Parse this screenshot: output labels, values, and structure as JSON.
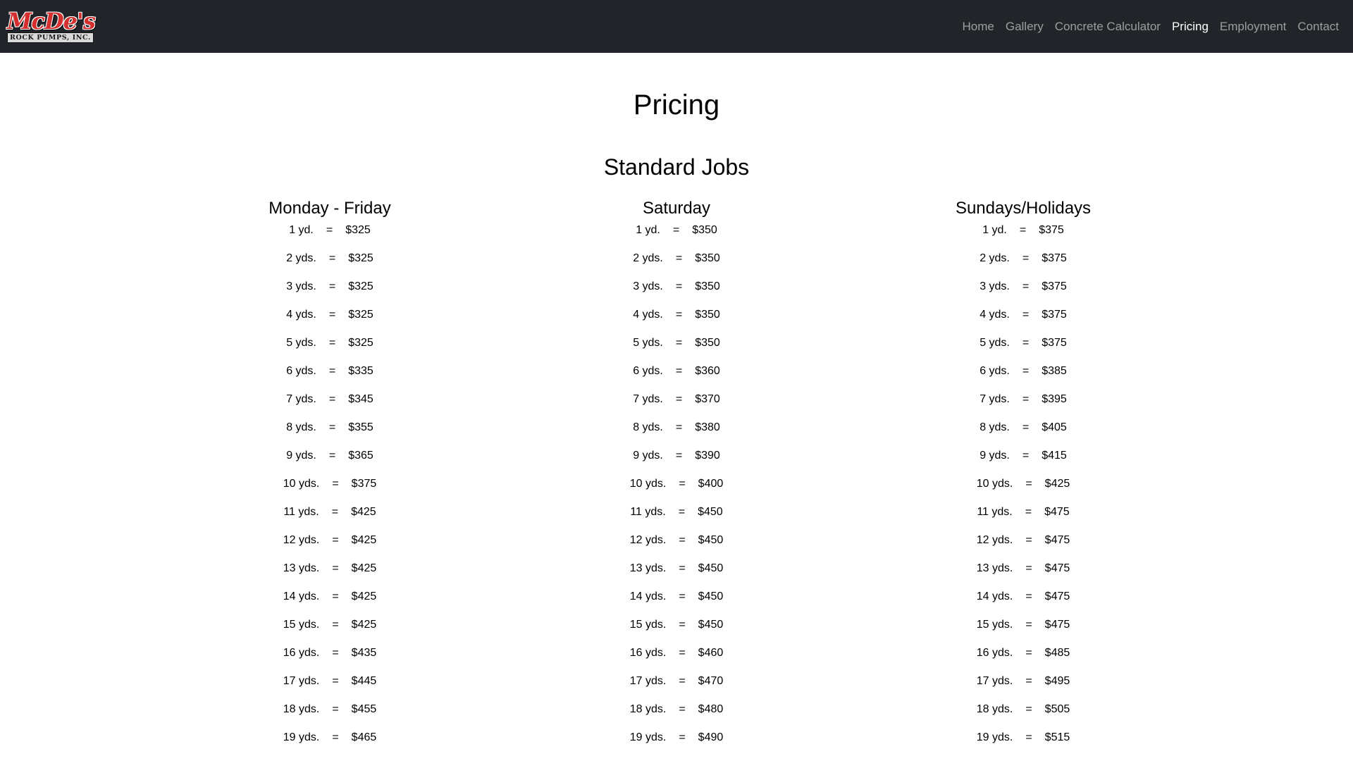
{
  "nav": {
    "logo_main": "McDe's",
    "logo_sub": "ROCK PUMPS, INC.",
    "links": [
      {
        "label": "Home",
        "active": false
      },
      {
        "label": "Gallery",
        "active": false
      },
      {
        "label": "Concrete Calculator",
        "active": false
      },
      {
        "label": "Pricing",
        "active": true
      },
      {
        "label": "Employment",
        "active": false
      },
      {
        "label": "Contact",
        "active": false
      }
    ]
  },
  "page": {
    "title": "Pricing",
    "section_title": "Standard Jobs"
  },
  "columns": [
    {
      "title": "Monday - Friday",
      "rows": [
        {
          "qty": "1 yd.",
          "price": "$325"
        },
        {
          "qty": "2 yds.",
          "price": "$325"
        },
        {
          "qty": "3 yds.",
          "price": "$325"
        },
        {
          "qty": "4 yds.",
          "price": "$325"
        },
        {
          "qty": "5 yds.",
          "price": "$325"
        },
        {
          "qty": "6 yds.",
          "price": "$335"
        },
        {
          "qty": "7 yds.",
          "price": "$345"
        },
        {
          "qty": "8 yds.",
          "price": "$355"
        },
        {
          "qty": "9 yds.",
          "price": "$365"
        },
        {
          "qty": "10 yds.",
          "price": "$375"
        },
        {
          "qty": "11 yds.",
          "price": "$425"
        },
        {
          "qty": "12 yds.",
          "price": "$425"
        },
        {
          "qty": "13 yds.",
          "price": "$425"
        },
        {
          "qty": "14 yds.",
          "price": "$425"
        },
        {
          "qty": "15 yds.",
          "price": "$425"
        },
        {
          "qty": "16 yds.",
          "price": "$435"
        },
        {
          "qty": "17 yds.",
          "price": "$445"
        },
        {
          "qty": "18 yds.",
          "price": "$455"
        },
        {
          "qty": "19 yds.",
          "price": "$465"
        }
      ]
    },
    {
      "title": "Saturday",
      "rows": [
        {
          "qty": "1 yd.",
          "price": "$350"
        },
        {
          "qty": "2 yds.",
          "price": "$350"
        },
        {
          "qty": "3 yds.",
          "price": "$350"
        },
        {
          "qty": "4 yds.",
          "price": "$350"
        },
        {
          "qty": "5 yds.",
          "price": "$350"
        },
        {
          "qty": "6 yds.",
          "price": "$360"
        },
        {
          "qty": "7 yds.",
          "price": "$370"
        },
        {
          "qty": "8 yds.",
          "price": "$380"
        },
        {
          "qty": "9 yds.",
          "price": "$390"
        },
        {
          "qty": "10 yds.",
          "price": "$400"
        },
        {
          "qty": "11 yds.",
          "price": "$450"
        },
        {
          "qty": "12 yds.",
          "price": "$450"
        },
        {
          "qty": "13 yds.",
          "price": "$450"
        },
        {
          "qty": "14 yds.",
          "price": "$450"
        },
        {
          "qty": "15 yds.",
          "price": "$450"
        },
        {
          "qty": "16 yds.",
          "price": "$460"
        },
        {
          "qty": "17 yds.",
          "price": "$470"
        },
        {
          "qty": "18 yds.",
          "price": "$480"
        },
        {
          "qty": "19 yds.",
          "price": "$490"
        }
      ]
    },
    {
      "title": "Sundays/Holidays",
      "rows": [
        {
          "qty": "1 yd.",
          "price": "$375"
        },
        {
          "qty": "2 yds.",
          "price": "$375"
        },
        {
          "qty": "3 yds.",
          "price": "$375"
        },
        {
          "qty": "4 yds.",
          "price": "$375"
        },
        {
          "qty": "5 yds.",
          "price": "$375"
        },
        {
          "qty": "6 yds.",
          "price": "$385"
        },
        {
          "qty": "7 yds.",
          "price": "$395"
        },
        {
          "qty": "8 yds.",
          "price": "$405"
        },
        {
          "qty": "9 yds.",
          "price": "$415"
        },
        {
          "qty": "10 yds.",
          "price": "$425"
        },
        {
          "qty": "11 yds.",
          "price": "$475"
        },
        {
          "qty": "12 yds.",
          "price": "$475"
        },
        {
          "qty": "13 yds.",
          "price": "$475"
        },
        {
          "qty": "14 yds.",
          "price": "$475"
        },
        {
          "qty": "15 yds.",
          "price": "$475"
        },
        {
          "qty": "16 yds.",
          "price": "$485"
        },
        {
          "qty": "17 yds.",
          "price": "$495"
        },
        {
          "qty": "18 yds.",
          "price": "$505"
        },
        {
          "qty": "19 yds.",
          "price": "$515"
        }
      ]
    }
  ],
  "equals_sign": "=",
  "colors": {
    "navbar_bg": "#212529",
    "nav_link": "rgba(255,255,255,0.55)",
    "nav_link_active": "#ffffff",
    "logo_red": "#d42e2e"
  }
}
